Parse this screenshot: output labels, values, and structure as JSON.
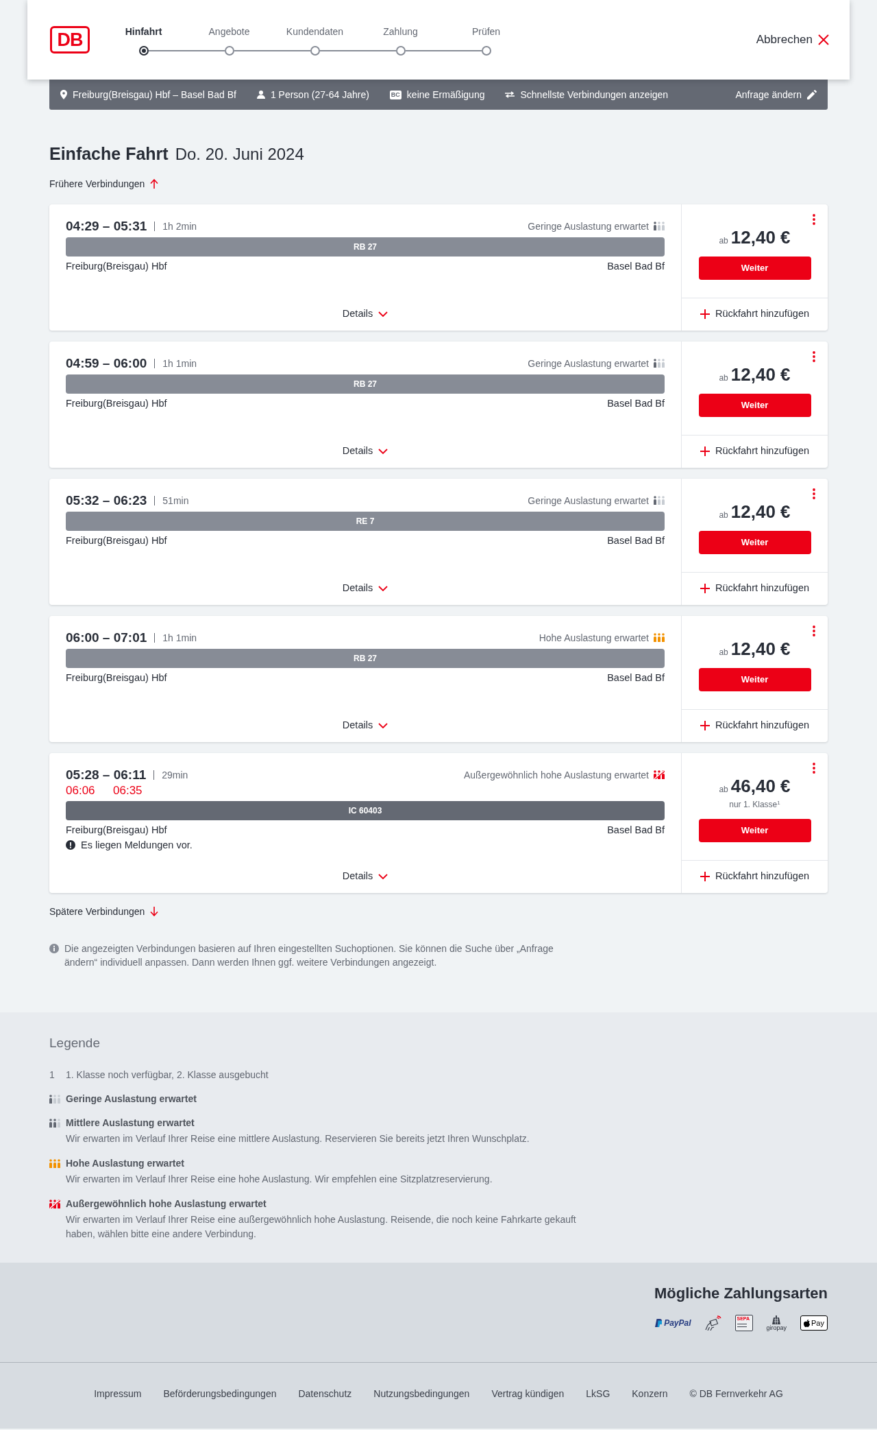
{
  "header": {
    "logo": "DB",
    "steps": [
      {
        "label": "Hinfahrt",
        "selected": true
      },
      {
        "label": "Angebote",
        "selected": false
      },
      {
        "label": "Kundendaten",
        "selected": false
      },
      {
        "label": "Zahlung",
        "selected": false
      },
      {
        "label": "Prüfen",
        "selected": false
      }
    ],
    "cancel": "Abbrechen"
  },
  "search_summary": {
    "items": [
      {
        "kind": "route",
        "text": "Freiburg(Breisgau) Hbf – Basel Bad Bf"
      },
      {
        "kind": "travellers",
        "text": "1 Person (27-64 Jahre)"
      },
      {
        "kind": "discount",
        "badge": "BC",
        "text": "keine Ermäßigung"
      },
      {
        "kind": "option",
        "text": "Schnellste Verbindungen anzeigen"
      }
    ],
    "edit": "Anfrage ändern"
  },
  "heading": {
    "title": "Einfache Fahrt",
    "date": "Do. 20. Juni 2024"
  },
  "earlier_link": "Frühere Verbindungen",
  "connections": [
    {
      "times": "04:29 – 05:31",
      "duration": "1h 2min",
      "load": {
        "kind": "low",
        "text": "Geringe Auslastung erwartet"
      },
      "train": {
        "kind": "regional",
        "name": "RB 27"
      },
      "from": "Freiburg(Breisgau) Hbf",
      "to": "Basel Bad Bf",
      "details": "Details",
      "price_prefix": "ab",
      "price": "12,40 €",
      "button": "Weiter",
      "return_link": "Rückfahrt hinzufügen"
    },
    {
      "times": "04:59 – 06:00",
      "duration": "1h 1min",
      "load": {
        "kind": "low",
        "text": "Geringe Auslastung erwartet"
      },
      "train": {
        "kind": "regional",
        "name": "RB 27"
      },
      "from": "Freiburg(Breisgau) Hbf",
      "to": "Basel Bad Bf",
      "details": "Details",
      "price_prefix": "ab",
      "price": "12,40 €",
      "button": "Weiter",
      "return_link": "Rückfahrt hinzufügen"
    },
    {
      "times": "05:32 – 06:23",
      "duration": "51min",
      "load": {
        "kind": "low",
        "text": "Geringe Auslastung erwartet"
      },
      "train": {
        "kind": "regional",
        "name": "RE 7"
      },
      "from": "Freiburg(Breisgau) Hbf",
      "to": "Basel Bad Bf",
      "details": "Details",
      "price_prefix": "ab",
      "price": "12,40 €",
      "button": "Weiter",
      "return_link": "Rückfahrt hinzufügen"
    },
    {
      "times": "06:00 – 07:01",
      "duration": "1h 1min",
      "load": {
        "kind": "high",
        "text": "Hohe Auslastung erwartet"
      },
      "train": {
        "kind": "regional",
        "name": "RB 27"
      },
      "from": "Freiburg(Breisgau) Hbf",
      "to": "Basel Bad Bf",
      "details": "Details",
      "price_prefix": "ab",
      "price": "12,40 €",
      "button": "Weiter",
      "return_link": "Rückfahrt hinzufügen"
    },
    {
      "times": "05:28 – 06:11",
      "duration": "29min",
      "realtime": {
        "departure": "06:06",
        "arrival": "06:35"
      },
      "load": {
        "kind": "very_high",
        "text": "Außergewöhnlich hohe Auslastung erwartet"
      },
      "train": {
        "kind": "long_distance",
        "name": "IC 60403"
      },
      "from": "Freiburg(Breisgau) Hbf",
      "to": "Basel Bad Bf",
      "message": "Es liegen Meldungen vor.",
      "details": "Details",
      "price_prefix": "ab",
      "price": "46,40 €",
      "price_note": "nur 1. Klasse$^{1}$",
      "button": "Weiter",
      "return_link": "Rückfahrt hinzufügen"
    }
  ],
  "later_link": "Spätere Verbindungen",
  "info_note": "Die angezeigten Verbindungen basieren auf Ihren eingestellten Suchoptionen. Sie können die Suche über „Anfrage ändern“ individuell anpassen. Dann werden Ihnen ggf. weitere Verbindungen angezeigt.",
  "legend": {
    "title": "Legende",
    "items": [
      {
        "kind": "footnote",
        "marker": "1",
        "text": "1. Klasse noch verfügbar, 2. Klasse ausgebucht"
      },
      {
        "kind": "low",
        "title": "Geringe Auslastung erwartet"
      },
      {
        "kind": "medium",
        "title": "Mittlere Auslastung erwartet",
        "description": "Wir erwarten im Verlauf Ihrer Reise eine mittlere Auslastung. Reservieren Sie bereits jetzt Ihren Wunschplatz."
      },
      {
        "kind": "high",
        "title": "Hohe Auslastung erwartet",
        "description": "Wir erwarten im Verlauf Ihrer Reise eine hohe Auslastung. Wir empfehlen eine Sitzplatzreservierung."
      },
      {
        "kind": "very_high",
        "title": "Außergewöhnlich hohe Auslastung erwartet",
        "description": "Wir erwarten im Verlauf Ihrer Reise eine außergewöhnlich hohe Auslastung. Reisende, die noch keine Fahrkarte gekauft haben, wählen bitte eine andere Verbindung."
      }
    ]
  },
  "payment": {
    "title": "Mögliche Zahlungsarten",
    "methods": [
      {
        "kind": "paypal",
        "label": "PayPal"
      },
      {
        "kind": "contactless"
      },
      {
        "kind": "sepa",
        "label": "SEPA"
      },
      {
        "kind": "giropay",
        "label": "giropay"
      },
      {
        "kind": "applepay",
        "label": "Pay"
      }
    ]
  },
  "footer_links": [
    "Impressum",
    "Beförderungsbedingungen",
    "Datenschutz",
    "Nutzungsbedingungen",
    "Vertrag kündigen",
    "LkSG",
    "Konzern",
    "© DB Fernverkehr AG"
  ]
}
